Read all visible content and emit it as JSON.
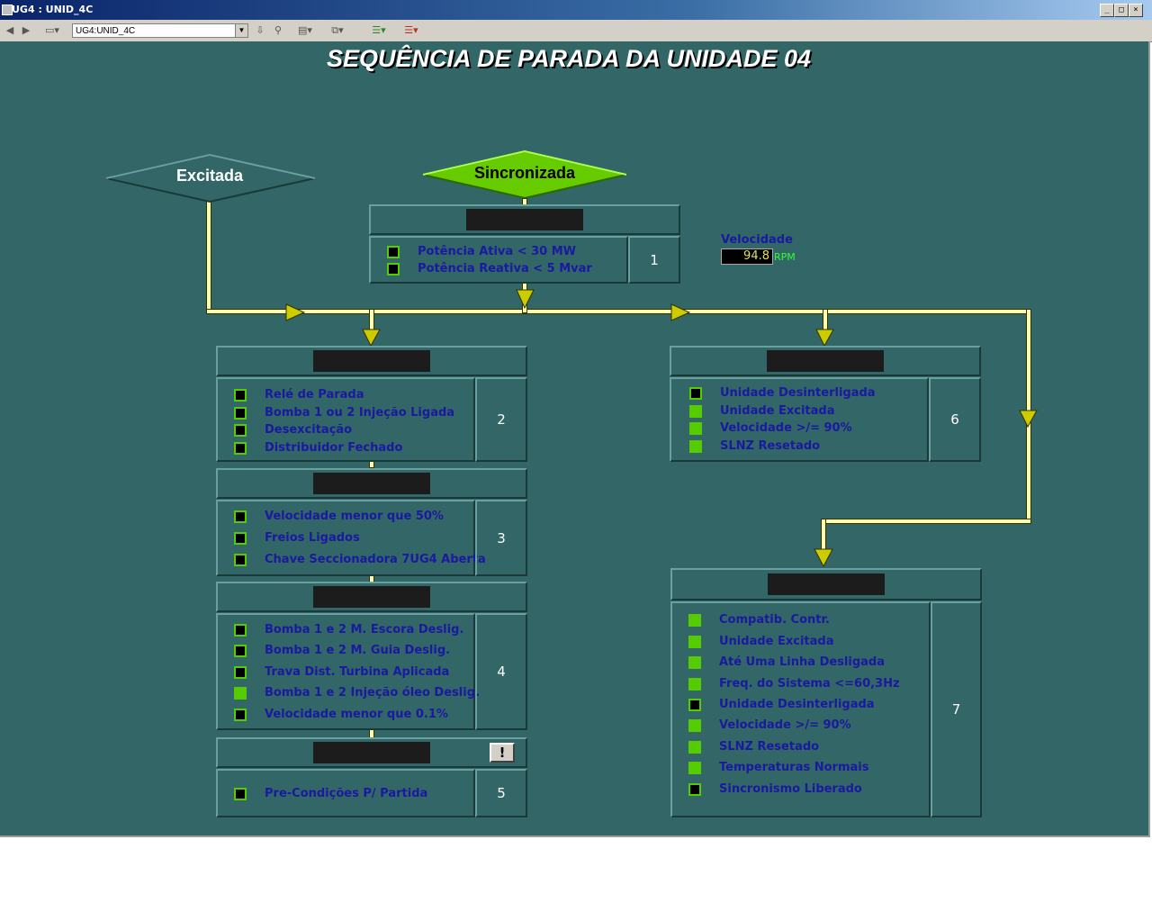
{
  "window": {
    "title": "UG4 : UNID_4C",
    "controls": [
      "_",
      "□",
      "×"
    ]
  },
  "toolbar": {
    "combo_value": "UG4:UNID_4C"
  },
  "page": {
    "title": "SEQUÊNCIA DE PARADA DA UNIDADE 04"
  },
  "states": {
    "excitada": "Excitada",
    "sincronizada": "Sincronizada"
  },
  "speed": {
    "label": "Velocidade",
    "value": "94.8",
    "unit": "RPM"
  },
  "colors": {
    "background": "#336666",
    "indicator_on": "#55cc00",
    "label_text": "#1a1aa0",
    "flow_line": "#ffffb0",
    "sincronizada_fill": "#66cc00",
    "excitada_fill": "#336666"
  },
  "steps": {
    "s1": {
      "number": "1",
      "items": [
        {
          "label": "Potência Ativa < 30 MW",
          "on": false
        },
        {
          "label": "Potência Reativa < 5 Mvar",
          "on": false
        }
      ]
    },
    "s2": {
      "number": "2",
      "items": [
        {
          "label": "Relé de Parada",
          "on": false
        },
        {
          "label": "Bomba 1 ou 2 Injeção Ligada",
          "on": false
        },
        {
          "label": "Desexcitação",
          "on": false
        },
        {
          "label": "Distribuidor Fechado",
          "on": false
        }
      ]
    },
    "s3": {
      "number": "3",
      "items": [
        {
          "label": "Velocidade menor que 50%",
          "on": false
        },
        {
          "label": "Freios Ligados",
          "on": false
        },
        {
          "label": "Chave Seccionadora 7UG4 Aberta",
          "on": false
        }
      ]
    },
    "s4": {
      "number": "4",
      "items": [
        {
          "label": "Bomba 1 e 2 M. Escora Deslig.",
          "on": false
        },
        {
          "label": "Bomba 1 e 2 M. Guia Deslig.",
          "on": false
        },
        {
          "label": "Trava Dist. Turbina Aplicada",
          "on": false
        },
        {
          "label": "Bomba 1 e 2 Injeção óleo Deslig.",
          "on": true
        },
        {
          "label": "Velocidade menor que 0.1%",
          "on": false
        }
      ]
    },
    "s5": {
      "number": "5",
      "alert": "!",
      "items": [
        {
          "label": "Pre-Condições P/ Partida",
          "on": false
        }
      ]
    },
    "s6": {
      "number": "6",
      "items": [
        {
          "label": "Unidade Desinterligada",
          "on": false
        },
        {
          "label": "Unidade Excitada",
          "on": true
        },
        {
          "label": "Velocidade  >/= 90%",
          "on": true
        },
        {
          "label": "SLNZ Resetado",
          "on": true
        }
      ]
    },
    "s7": {
      "number": "7",
      "items": [
        {
          "label": "Compatib. Contr.",
          "on": true
        },
        {
          "label": "Unidade Excitada",
          "on": true
        },
        {
          "label": "Até Uma Linha Desligada",
          "on": true
        },
        {
          "label": "Freq. do Sistema <=60,3Hz",
          "on": true
        },
        {
          "label": "Unidade Desinterligada",
          "on": false
        },
        {
          "label": "Velocidade  >/= 90%",
          "on": true
        },
        {
          "label": "SLNZ Resetado",
          "on": true
        },
        {
          "label": "Temperaturas Normais",
          "on": true
        },
        {
          "label": "Sincronismo Liberado",
          "on": false
        }
      ]
    }
  }
}
